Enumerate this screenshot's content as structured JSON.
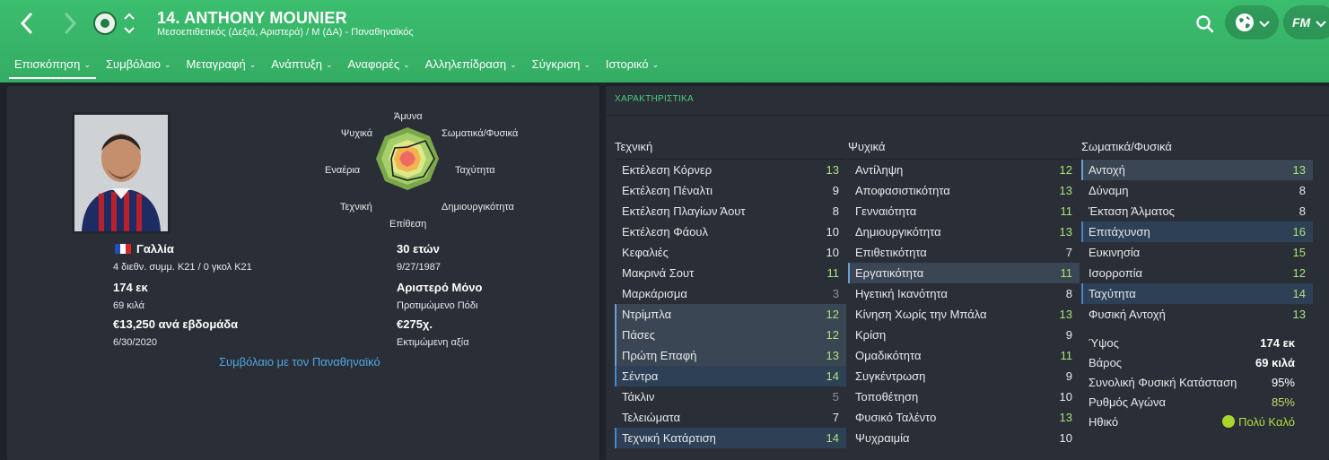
{
  "header": {
    "title": "14. ANTHONY MOUNIER",
    "subtitle": "Μεσοεπιθετικός (Δεξιά, Αριστερά) / Μ (ΔΑ) - Παναθηναϊκός",
    "logo_text": "FM",
    "brand_color": "#3bbd6e"
  },
  "tabs": [
    {
      "label": "Επισκόπηση",
      "active": true
    },
    {
      "label": "Συμβόλαιο"
    },
    {
      "label": "Μεταγραφή"
    },
    {
      "label": "Ανάπτυξη"
    },
    {
      "label": "Αναφορές"
    },
    {
      "label": "Αλληλεπίδραση"
    },
    {
      "label": "Σύγκριση"
    },
    {
      "label": "Ιστορικό"
    }
  ],
  "overview": {
    "radar": {
      "top": "Άμυνα",
      "top_right": "Σωματικά/Φυσικά",
      "right": "Ταχύτητα",
      "bottom_right": "Δημιουργικότητα",
      "bottom": "Επίθεση",
      "bottom_left": "Τεχνική",
      "left": "Εναέρια",
      "top_left": "Ψυχικά"
    },
    "nationality": "Γαλλία",
    "caps": "4 διεθν. συμμ. Κ21 / 0 γκολ Κ21",
    "age": "30 ετών",
    "dob": "9/27/1987",
    "height": "174 εκ",
    "weight": "69 κιλά",
    "foot": "Αριστερό Μόνο",
    "foot_label": "Προτιμώμενο Πόδι",
    "wage": "€13,250 ανά εβδομάδα",
    "contract_end": "6/30/2020",
    "value": "€275χ.",
    "value_label": "Εκτιμώμενη αξία",
    "contract_link": "Συμβόλαιο με τον Παναθηναϊκό"
  },
  "attributes": {
    "title": "ΧΑΡΑΚΤΗΡΙΣΤΙΚΑ",
    "technical": {
      "heading": "Τεχνική",
      "items": [
        {
          "name": "Εκτέλεση Κόρνερ",
          "value": "13",
          "tone": "green"
        },
        {
          "name": "Εκτέλεση Πέναλτι",
          "value": "9",
          "tone": "white"
        },
        {
          "name": "Εκτέλεση Πλαγίων Άουτ",
          "value": "8",
          "tone": "white"
        },
        {
          "name": "Εκτέλεση Φάουλ",
          "value": "10",
          "tone": "white"
        },
        {
          "name": "Κεφαλιές",
          "value": "10",
          "tone": "white"
        },
        {
          "name": "Μακρινά Σουτ",
          "value": "11",
          "tone": "green"
        },
        {
          "name": "Μαρκάρισμα",
          "value": "3",
          "tone": "grey"
        },
        {
          "name": "Ντρίμπλα",
          "value": "12",
          "tone": "green",
          "hl": "hl"
        },
        {
          "name": "Πάσες",
          "value": "12",
          "tone": "green",
          "hl": "hl"
        },
        {
          "name": "Πρώτη Επαφή",
          "value": "13",
          "tone": "green",
          "hl": "hl"
        },
        {
          "name": "Σέντρα",
          "value": "14",
          "tone": "green",
          "hl": "hl2"
        },
        {
          "name": "Τάκλιν",
          "value": "5",
          "tone": "grey"
        },
        {
          "name": "Τελειώματα",
          "value": "7",
          "tone": "white"
        },
        {
          "name": "Τεχνική Κατάρτιση",
          "value": "14",
          "tone": "green",
          "hl": "hl2"
        }
      ]
    },
    "mental": {
      "heading": "Ψυχικά",
      "items": [
        {
          "name": "Αντίληψη",
          "value": "12",
          "tone": "green"
        },
        {
          "name": "Αποφασιστικότητα",
          "value": "13",
          "tone": "green"
        },
        {
          "name": "Γενναιότητα",
          "value": "11",
          "tone": "green"
        },
        {
          "name": "Δημιουργικότητα",
          "value": "13",
          "tone": "green"
        },
        {
          "name": "Επιθετικότητα",
          "value": "7",
          "tone": "white"
        },
        {
          "name": "Εργατικότητα",
          "value": "11",
          "tone": "green",
          "hl": "hl"
        },
        {
          "name": "Ηγετική Ικανότητα",
          "value": "8",
          "tone": "white"
        },
        {
          "name": "Κίνηση Χωρίς την Μπάλα",
          "value": "13",
          "tone": "green"
        },
        {
          "name": "Κρίση",
          "value": "9",
          "tone": "white"
        },
        {
          "name": "Ομαδικότητα",
          "value": "11",
          "tone": "green"
        },
        {
          "name": "Συγκέντρωση",
          "value": "9",
          "tone": "white"
        },
        {
          "name": "Τοποθέτηση",
          "value": "10",
          "tone": "white"
        },
        {
          "name": "Φυσικό Ταλέντο",
          "value": "13",
          "tone": "green"
        },
        {
          "name": "Ψυχραιμία",
          "value": "10",
          "tone": "white"
        }
      ]
    },
    "physical": {
      "heading": "Σωματικά/Φυσικά",
      "items": [
        {
          "name": "Αντοχή",
          "value": "13",
          "tone": "green",
          "hl": "hl"
        },
        {
          "name": "Δύναμη",
          "value": "8",
          "tone": "white"
        },
        {
          "name": "Έκταση Άλματος",
          "value": "8",
          "tone": "white"
        },
        {
          "name": "Επιτάχυνση",
          "value": "16",
          "tone": "green",
          "hl": "hl2"
        },
        {
          "name": "Ευκινησία",
          "value": "15",
          "tone": "green"
        },
        {
          "name": "Ισορροπία",
          "value": "12",
          "tone": "green"
        },
        {
          "name": "Ταχύτητα",
          "value": "14",
          "tone": "green",
          "hl": "hl2"
        },
        {
          "name": "Φυσική Αντοχή",
          "value": "13",
          "tone": "green"
        }
      ]
    },
    "physical_info": [
      {
        "name": "Ύψος",
        "value": "174 εκ",
        "style": "b"
      },
      {
        "name": "Βάρος",
        "value": "69 κιλά",
        "style": "b"
      },
      {
        "name": "Συνολική Φυσική Κατάσταση",
        "value": "95%",
        "style": "w"
      },
      {
        "name": "Ρυθμός Αγώνα",
        "value": "85%",
        "style": "y"
      },
      {
        "name": "Ηθικό",
        "value": "Πολύ Καλό",
        "style": "g"
      }
    ]
  }
}
